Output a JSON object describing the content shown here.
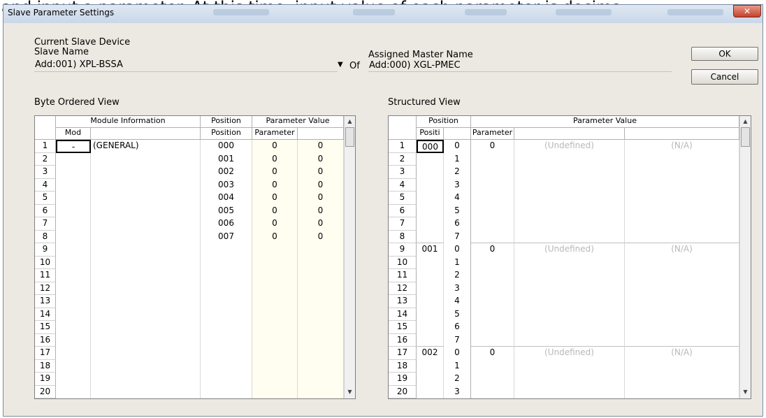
{
  "background_caption": "and input a parameter. At this time, input value of each parameter is decima",
  "window": {
    "title": "Slave Parameter Settings"
  },
  "labels": {
    "current_device": "Current Slave Device",
    "slave_name": "Slave Name",
    "assigned_master": "Assigned Master Name",
    "of": "Of",
    "byte_view": "Byte Ordered View",
    "structured_view": "Structured View"
  },
  "fields": {
    "slave_name": "Add:001) XPL-BSSA",
    "master_name": "Add:000) XGL-PMEC"
  },
  "buttons": {
    "ok": "OK",
    "cancel": "Cancel"
  },
  "byte_grid": {
    "headers": {
      "module_info": "Module Information",
      "position": "Position",
      "param_value": "Parameter Value",
      "mod": "Mod",
      "position_sub": "Position",
      "parameter": "Parameter"
    },
    "rows": [
      {
        "n": "1",
        "mod": "-",
        "info": "(GENERAL)",
        "pos": "000",
        "p1": "0",
        "p2": "0"
      },
      {
        "n": "2",
        "mod": "",
        "info": "",
        "pos": "001",
        "p1": "0",
        "p2": "0"
      },
      {
        "n": "3",
        "mod": "",
        "info": "",
        "pos": "002",
        "p1": "0",
        "p2": "0"
      },
      {
        "n": "4",
        "mod": "",
        "info": "",
        "pos": "003",
        "p1": "0",
        "p2": "0"
      },
      {
        "n": "5",
        "mod": "",
        "info": "",
        "pos": "004",
        "p1": "0",
        "p2": "0"
      },
      {
        "n": "6",
        "mod": "",
        "info": "",
        "pos": "005",
        "p1": "0",
        "p2": "0"
      },
      {
        "n": "7",
        "mod": "",
        "info": "",
        "pos": "006",
        "p1": "0",
        "p2": "0"
      },
      {
        "n": "8",
        "mod": "",
        "info": "",
        "pos": "007",
        "p1": "0",
        "p2": "0"
      },
      {
        "n": "9",
        "mod": "",
        "info": "",
        "pos": "",
        "p1": "",
        "p2": ""
      },
      {
        "n": "10",
        "mod": "",
        "info": "",
        "pos": "",
        "p1": "",
        "p2": ""
      },
      {
        "n": "11",
        "mod": "",
        "info": "",
        "pos": "",
        "p1": "",
        "p2": ""
      },
      {
        "n": "12",
        "mod": "",
        "info": "",
        "pos": "",
        "p1": "",
        "p2": ""
      },
      {
        "n": "13",
        "mod": "",
        "info": "",
        "pos": "",
        "p1": "",
        "p2": ""
      },
      {
        "n": "14",
        "mod": "",
        "info": "",
        "pos": "",
        "p1": "",
        "p2": ""
      },
      {
        "n": "15",
        "mod": "",
        "info": "",
        "pos": "",
        "p1": "",
        "p2": ""
      },
      {
        "n": "16",
        "mod": "",
        "info": "",
        "pos": "",
        "p1": "",
        "p2": ""
      },
      {
        "n": "17",
        "mod": "",
        "info": "",
        "pos": "",
        "p1": "",
        "p2": ""
      },
      {
        "n": "18",
        "mod": "",
        "info": "",
        "pos": "",
        "p1": "",
        "p2": ""
      },
      {
        "n": "19",
        "mod": "",
        "info": "",
        "pos": "",
        "p1": "",
        "p2": ""
      },
      {
        "n": "20",
        "mod": "",
        "info": "",
        "pos": "",
        "p1": "",
        "p2": ""
      }
    ]
  },
  "struct_grid": {
    "headers": {
      "position": "Position",
      "param_value": "Parameter Value",
      "positi": "Positi",
      "parameter": "Parameter"
    },
    "rows": [
      {
        "n": "1",
        "pos": "000",
        "bit": "0",
        "param": "0",
        "c3": "(Undefined)",
        "c4": "(N/A)"
      },
      {
        "n": "2",
        "pos": "",
        "bit": "1",
        "param": "",
        "c3": "",
        "c4": ""
      },
      {
        "n": "3",
        "pos": "",
        "bit": "2",
        "param": "",
        "c3": "",
        "c4": ""
      },
      {
        "n": "4",
        "pos": "",
        "bit": "3",
        "param": "",
        "c3": "",
        "c4": ""
      },
      {
        "n": "5",
        "pos": "",
        "bit": "4",
        "param": "",
        "c3": "",
        "c4": ""
      },
      {
        "n": "6",
        "pos": "",
        "bit": "5",
        "param": "",
        "c3": "",
        "c4": ""
      },
      {
        "n": "7",
        "pos": "",
        "bit": "6",
        "param": "",
        "c3": "",
        "c4": ""
      },
      {
        "n": "8",
        "pos": "",
        "bit": "7",
        "param": "",
        "c3": "",
        "c4": ""
      },
      {
        "n": "9",
        "pos": "001",
        "bit": "0",
        "param": "0",
        "c3": "(Undefined)",
        "c4": "(N/A)"
      },
      {
        "n": "10",
        "pos": "",
        "bit": "1",
        "param": "",
        "c3": "",
        "c4": ""
      },
      {
        "n": "11",
        "pos": "",
        "bit": "2",
        "param": "",
        "c3": "",
        "c4": ""
      },
      {
        "n": "12",
        "pos": "",
        "bit": "3",
        "param": "",
        "c3": "",
        "c4": ""
      },
      {
        "n": "13",
        "pos": "",
        "bit": "4",
        "param": "",
        "c3": "",
        "c4": ""
      },
      {
        "n": "14",
        "pos": "",
        "bit": "5",
        "param": "",
        "c3": "",
        "c4": ""
      },
      {
        "n": "15",
        "pos": "",
        "bit": "6",
        "param": "",
        "c3": "",
        "c4": ""
      },
      {
        "n": "16",
        "pos": "",
        "bit": "7",
        "param": "",
        "c3": "",
        "c4": ""
      },
      {
        "n": "17",
        "pos": "002",
        "bit": "0",
        "param": "0",
        "c3": "(Undefined)",
        "c4": "(N/A)"
      },
      {
        "n": "18",
        "pos": "",
        "bit": "1",
        "param": "",
        "c3": "",
        "c4": ""
      },
      {
        "n": "19",
        "pos": "",
        "bit": "2",
        "param": "",
        "c3": "",
        "c4": ""
      },
      {
        "n": "20",
        "pos": "",
        "bit": "3",
        "param": "",
        "c3": "",
        "c4": ""
      }
    ]
  },
  "icons": {
    "close": "close-icon",
    "dropdown": "chevron-down-icon",
    "scroll_up": "scroll-up-arrow-icon",
    "scroll_down": "scroll-down-arrow-icon"
  },
  "colors": {
    "param_col_bg": "#fffef0",
    "title_bar": "#c9d7e8",
    "close_button": "#c6412d"
  }
}
